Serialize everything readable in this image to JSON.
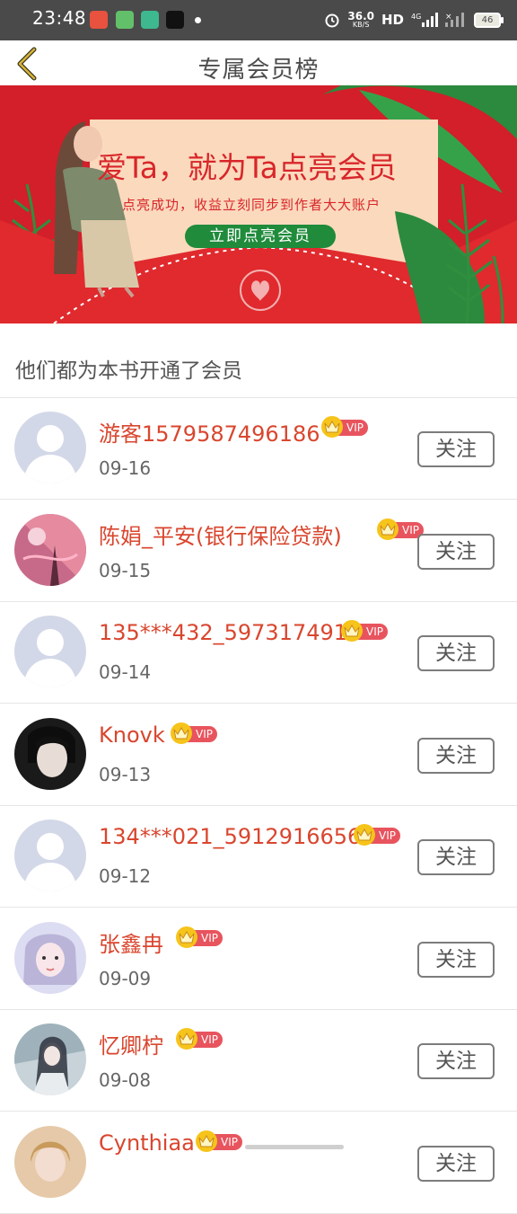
{
  "status_bar": {
    "time": "23:48",
    "net_speed": "36.0",
    "net_unit": "KB/S",
    "hd_label": "HD",
    "signal_label": "4G",
    "battery": "46"
  },
  "header": {
    "title": "专属会员榜",
    "back_icon": "chevron-left-icon"
  },
  "banner": {
    "headline": "爱Ta，就为Ta点亮会员",
    "subline": "点亮成功，收益立刻同步到作者大大账户",
    "cta": "立即点亮会员"
  },
  "section": {
    "title": "他们都为本书开通了会员"
  },
  "vip_label": "VIP",
  "follow_label": "关注",
  "members": [
    {
      "name": "游客1579587496186",
      "date": "09-16",
      "avatar": "default"
    },
    {
      "name": "陈娟_平安(银行保险贷款)",
      "date": "09-15",
      "avatar": "pink-flowers"
    },
    {
      "name": "135***432_597317491",
      "date": "09-14",
      "avatar": "default"
    },
    {
      "name": "Knovk",
      "date": "09-13",
      "avatar": "dark-portrait"
    },
    {
      "name": "134***021_5912916656",
      "date": "09-12",
      "avatar": "default"
    },
    {
      "name": "张鑫冉",
      "date": "09-09",
      "avatar": "girl-portrait"
    },
    {
      "name": "忆卿柠",
      "date": "09-08",
      "avatar": "illustration"
    },
    {
      "name": "Cynthiaa",
      "date": "",
      "avatar": "blonde-portrait"
    }
  ],
  "colors": {
    "accent_name": "#d9462e",
    "vip_tag": "#e8545e",
    "vip_crown": "#f6c41a",
    "banner_red": "#d21f2a",
    "cta_green": "#1f8b3b"
  }
}
